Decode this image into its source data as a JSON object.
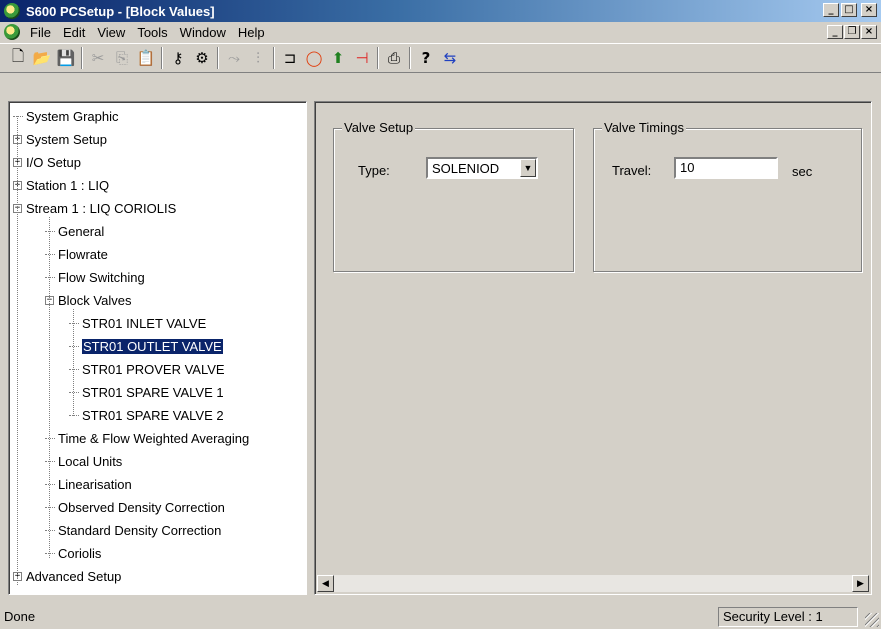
{
  "window": {
    "title": "S600 PCSetup - [Block Values]",
    "controls": [
      "_",
      "□",
      "×"
    ]
  },
  "menu": {
    "items": [
      "File",
      "Edit",
      "View",
      "Tools",
      "Window",
      "Help"
    ],
    "mdi_controls": [
      "_",
      "❐",
      "×"
    ]
  },
  "toolbar": {
    "icons": [
      "new-icon",
      "open-icon",
      "save-icon",
      "cut-icon",
      "copy-icon",
      "paste-icon",
      "key-icon",
      "wizard-icon",
      "connect-icon",
      "settings-icon",
      "input-icon",
      "stop-icon",
      "download-icon",
      "upload-icon",
      "print-icon",
      "help-icon",
      "transfer-icon"
    ]
  },
  "tree": {
    "items": [
      {
        "label": "System Graphic",
        "level": 0,
        "expander": ""
      },
      {
        "label": "System Setup",
        "level": 0,
        "expander": "+"
      },
      {
        "label": "I/O Setup",
        "level": 0,
        "expander": "+"
      },
      {
        "label": "Station 1 : LIQ",
        "level": 0,
        "expander": "+"
      },
      {
        "label": "Stream 1 : LIQ CORIOLIS",
        "level": 0,
        "expander": "-"
      },
      {
        "label": "General",
        "level": 1,
        "expander": ""
      },
      {
        "label": "Flowrate",
        "level": 1,
        "expander": ""
      },
      {
        "label": "Flow Switching",
        "level": 1,
        "expander": ""
      },
      {
        "label": "Block Valves",
        "level": 1,
        "expander": "-"
      },
      {
        "label": "STR01 INLET VALVE",
        "level": 2,
        "expander": ""
      },
      {
        "label": "STR01 OUTLET VALVE",
        "level": 2,
        "expander": "",
        "selected": true
      },
      {
        "label": "STR01 PROVER VALVE",
        "level": 2,
        "expander": ""
      },
      {
        "label": "STR01 SPARE VALVE 1",
        "level": 2,
        "expander": ""
      },
      {
        "label": "STR01 SPARE VALVE 2",
        "level": 2,
        "expander": ""
      },
      {
        "label": "Time & Flow Weighted Averaging",
        "level": 1,
        "expander": ""
      },
      {
        "label": "Local Units",
        "level": 1,
        "expander": ""
      },
      {
        "label": "Linearisation",
        "level": 1,
        "expander": ""
      },
      {
        "label": "Observed Density Correction",
        "level": 1,
        "expander": ""
      },
      {
        "label": "Standard Density Correction",
        "level": 1,
        "expander": ""
      },
      {
        "label": "Coriolis",
        "level": 1,
        "expander": ""
      },
      {
        "label": "Advanced Setup",
        "level": 0,
        "expander": "+"
      }
    ]
  },
  "valve_setup": {
    "group_label": "Valve Setup",
    "type_label": "Type:",
    "type_value": "SOLENIOD"
  },
  "valve_timings": {
    "group_label": "Valve Timings",
    "travel_label": "Travel:",
    "travel_value": "10",
    "unit": "sec"
  },
  "status": {
    "text": "Done",
    "security": "Security Level : 1"
  }
}
